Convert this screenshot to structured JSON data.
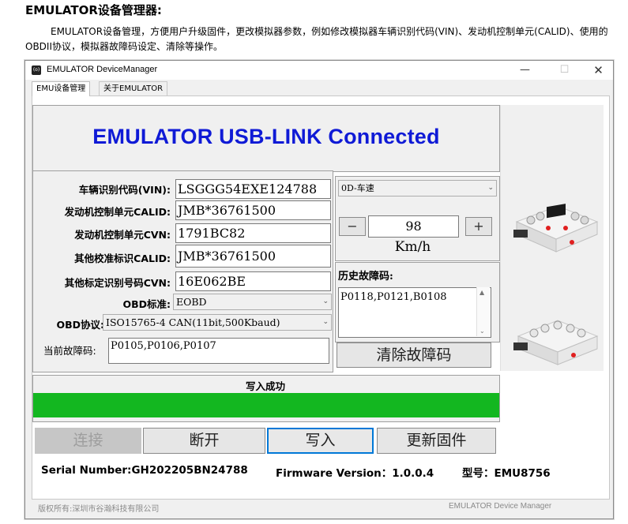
{
  "doc": {
    "title": "EMULATOR设备管理器:",
    "description": "EMULATOR设备管理，方便用户升级固件，更改模拟器参数，例如修改模拟器车辆识别代码(VIN)、发动机控制单元(CALID)、使用的OBDII协议，模拟器故障码设定、清除等操作。"
  },
  "window": {
    "title": "EMULATOR DeviceManager",
    "app_icon": "(o)",
    "minimize": "—",
    "maximize": "☐",
    "close": "✕"
  },
  "tabs": [
    {
      "label": "EMU设备管理"
    },
    {
      "label": "关于EMULATOR"
    }
  ],
  "headline": "EMULATOR USB-LINK Connected",
  "form": {
    "vin_label": "车辆识别代码(VIN):",
    "vin_value": "LSGGG54EXE124788",
    "calid_label": "发动机控制单元CALID:",
    "calid_value": "JMB*36761500",
    "cvn_label": "发动机控制单元CVN:",
    "cvn_value": "1791BC82",
    "other_calid_label": "其他校准标识CALID:",
    "other_calid_value": "JMB*36761500",
    "other_cvn_label": "其他标定识别号码CVN:",
    "other_cvn_value": "16E062BE",
    "obd_std_label": "OBD标准:",
    "obd_std_value": "EOBD",
    "obd_proto_label": "OBD协议:",
    "obd_proto_value": "ISO15765-4 CAN(11bit,500Kbaud)",
    "current_dtc_label": "当前故障码:",
    "current_dtc_value": "P0105,P0106,P0107"
  },
  "speed": {
    "pid_value": "0D-车速",
    "minus": "−",
    "plus": "+",
    "value": "98",
    "unit": "Km/h"
  },
  "history": {
    "label": "历史故障码:",
    "value": "P0118,P0121,B0108"
  },
  "buttons": {
    "clear_dtc": "清除故障码",
    "connect": "连接",
    "disconnect": "断开",
    "write": "写入",
    "update_fw": "更新固件"
  },
  "status": {
    "text": "写入成功",
    "progress": 1.0,
    "color": "#13b720"
  },
  "info": {
    "serial": "Serial Number:GH202205BN24788",
    "firmware": "Firmware Version：1.0.0.4",
    "model": "型号：EMU8756"
  },
  "footer": {
    "copyright": "版权所有:深圳市谷瀚科技有限公司",
    "app_name": "EMULATOR Device Manager"
  },
  "colors": {
    "headline": "#0f1ad6",
    "accent": "#0078d7"
  }
}
